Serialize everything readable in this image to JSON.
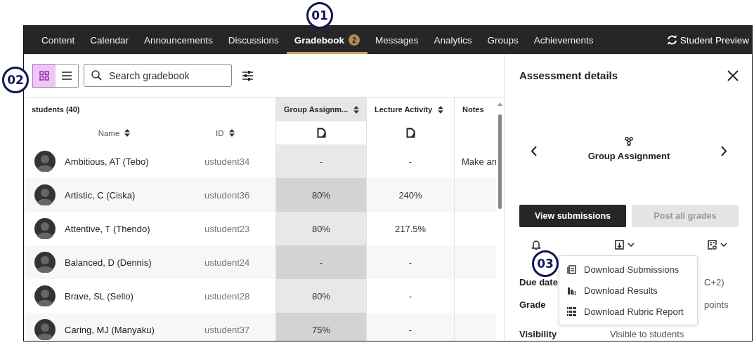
{
  "callouts": [
    "01",
    "02",
    "03"
  ],
  "nav": {
    "tabs": [
      {
        "label": "Content",
        "selected": false
      },
      {
        "label": "Calendar",
        "selected": false
      },
      {
        "label": "Announcements",
        "selected": false
      },
      {
        "label": "Discussions",
        "selected": false
      },
      {
        "label": "Gradebook",
        "selected": true,
        "badge": "2"
      },
      {
        "label": "Messages",
        "selected": false
      },
      {
        "label": "Analytics",
        "selected": false
      },
      {
        "label": "Groups",
        "selected": false
      },
      {
        "label": "Achievements",
        "selected": false
      }
    ],
    "student_preview": "Student Preview"
  },
  "toolbar": {
    "views": [
      {
        "kind": "grid",
        "selected": true
      },
      {
        "kind": "list",
        "selected": false
      }
    ],
    "search": {
      "placeholder": "Search gradebook"
    }
  },
  "table": {
    "students_label": "students (40)",
    "name_header": "Name",
    "id_header": "ID",
    "columns": [
      {
        "label": "Group Assignm...",
        "selected": true,
        "sortable": true
      },
      {
        "label": "Lecture Activity",
        "selected": false,
        "sortable": true
      },
      {
        "label": "Notes",
        "selected": false,
        "sortable": false
      }
    ],
    "rows": [
      {
        "name": "Ambitious, AT (Tebo)",
        "id": "ustudent34",
        "cells": [
          "-",
          "-",
          "Make an"
        ]
      },
      {
        "name": "Artistic, C (Ciska)",
        "id": "ustudent36",
        "cells": [
          "80%",
          "240%",
          ""
        ]
      },
      {
        "name": "Attentive, T (Thendo)",
        "id": "ustudent23",
        "cells": [
          "80%",
          "217.5%",
          ""
        ]
      },
      {
        "name": "Balanced, D (Dennis)",
        "id": "ustudent24",
        "cells": [
          "-",
          "-",
          ""
        ]
      },
      {
        "name": "Brave, SL (Sello)",
        "id": "ustudent28",
        "cells": [
          "80%",
          "-",
          ""
        ]
      },
      {
        "name": "Caring, MJ (Manyaku)",
        "id": "ustudent37",
        "cells": [
          "75%",
          "-",
          ""
        ]
      }
    ]
  },
  "panel": {
    "title": "Assessment details",
    "assessment": "Group Assignment",
    "buttons": [
      {
        "label": "View submissions",
        "disabled": false
      },
      {
        "label": "Post all grades",
        "disabled": true
      }
    ],
    "details": [
      {
        "label": "Due date",
        "value": "C+2)",
        "kind": "covered"
      },
      {
        "label": "Grade",
        "value": "points",
        "kind": "covered"
      },
      {
        "label": "Visibility",
        "value": "Visible to students",
        "kind": "plain"
      }
    ],
    "menu": [
      {
        "kind": "submissions",
        "label": "Download Submissions"
      },
      {
        "kind": "results",
        "label": "Download Results"
      },
      {
        "kind": "rubric",
        "label": "Download Rubric Report"
      }
    ]
  }
}
